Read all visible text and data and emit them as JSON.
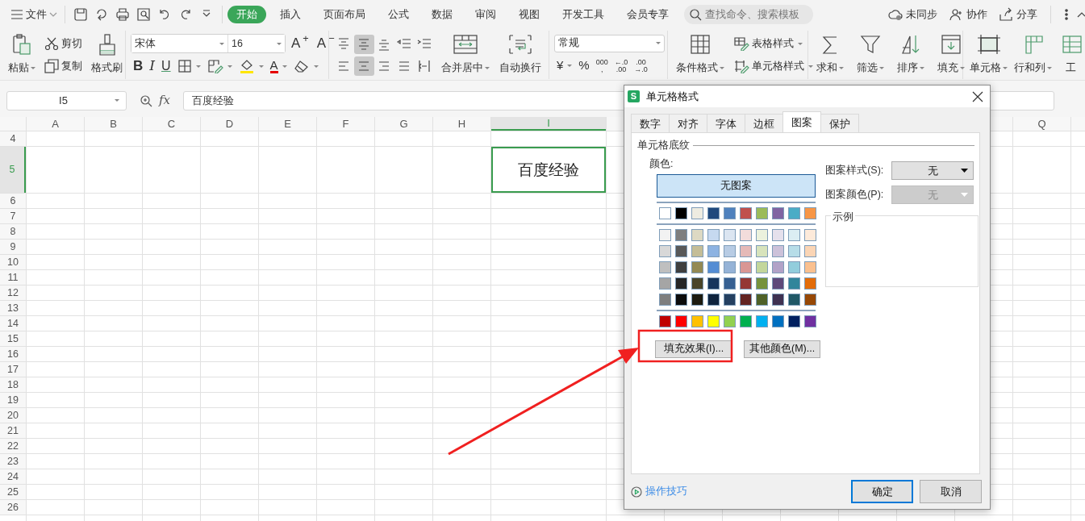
{
  "topbar": {
    "menu": "文件",
    "tabs": [
      {
        "label": "开始",
        "selected": true
      },
      {
        "label": "插入",
        "selected": false
      },
      {
        "label": "页面布局",
        "selected": false
      },
      {
        "label": "公式",
        "selected": false
      },
      {
        "label": "数据",
        "selected": false
      },
      {
        "label": "审阅",
        "selected": false
      },
      {
        "label": "视图",
        "selected": false
      },
      {
        "label": "开发工具",
        "selected": false
      },
      {
        "label": "会员专享",
        "selected": false
      }
    ],
    "search": {
      "placeholder": "查找命令、搜索模板"
    },
    "actions": [
      "未同步",
      "协作",
      "分享"
    ]
  },
  "ribbon": {
    "clipboard": {
      "paste": "粘贴",
      "cut": "剪切",
      "copy": "复制",
      "format_painter": "格式刷"
    },
    "font": {
      "name": "宋体",
      "size": "16",
      "grow": "A$^{+}$",
      "shrink": "A$^{−}$",
      "bold": "B",
      "italic": "I",
      "underline": "U",
      "font_color": "A"
    },
    "alignment": {
      "buttons": [
        {
          "selected": false
        },
        {
          "selected": true
        },
        {
          "selected": false
        },
        {
          "selected": false
        },
        {
          "selected": false
        },
        {
          "selected": false
        },
        {
          "selected": true
        },
        {
          "selected": false
        },
        {
          "selected": false
        },
        {
          "selected": false
        }
      ],
      "merge": "合并居中",
      "wrap": "自动换行"
    },
    "number": {
      "format": "常规",
      "currency": "¥",
      "percent": "%",
      "thousands": [
        "000",
        ","
      ],
      "increase_decimal": [
        "←.0",
        ".00"
      ],
      "decrease_decimal": [
        ".00",
        "→.0"
      ]
    },
    "styles": {
      "conditional": "条件格式",
      "table_style": "表格样式",
      "cell_style": "单元格样式"
    },
    "editing": [
      "求和",
      "筛选",
      "排序",
      "填充"
    ],
    "cells": [
      "单元格",
      "行和列",
      "工"
    ]
  },
  "formula_bar": {
    "name_box": "I5",
    "fx": "fx",
    "value": "百度经验"
  },
  "sheet": {
    "columns_left": [
      {
        "label": "A",
        "selected": false
      },
      {
        "label": "B",
        "selected": false
      },
      {
        "label": "C",
        "selected": false
      },
      {
        "label": "D",
        "selected": false
      },
      {
        "label": "E",
        "selected": false
      },
      {
        "label": "F",
        "selected": false
      },
      {
        "label": "G",
        "selected": false
      },
      {
        "label": "H",
        "selected": false
      },
      {
        "label": "I",
        "selected": true
      }
    ],
    "columns_right": [
      {
        "label": "Q",
        "selected": false
      }
    ],
    "rows": [
      {
        "label": "4",
        "selected": false,
        "tall": false
      },
      {
        "label": "5",
        "selected": true,
        "tall": true
      },
      {
        "label": "6",
        "selected": false,
        "tall": false
      },
      {
        "label": "7",
        "selected": false,
        "tall": false
      },
      {
        "label": "8",
        "selected": false,
        "tall": false
      },
      {
        "label": "9",
        "selected": false,
        "tall": false
      },
      {
        "label": "10",
        "selected": false,
        "tall": false
      },
      {
        "label": "11",
        "selected": false,
        "tall": false
      },
      {
        "label": "12",
        "selected": false,
        "tall": false
      },
      {
        "label": "13",
        "selected": false,
        "tall": false
      },
      {
        "label": "14",
        "selected": false,
        "tall": false
      },
      {
        "label": "15",
        "selected": false,
        "tall": false
      },
      {
        "label": "16",
        "selected": false,
        "tall": false
      },
      {
        "label": "17",
        "selected": false,
        "tall": false
      },
      {
        "label": "18",
        "selected": false,
        "tall": false
      },
      {
        "label": "19",
        "selected": false,
        "tall": false
      },
      {
        "label": "20",
        "selected": false,
        "tall": false
      },
      {
        "label": "21",
        "selected": false,
        "tall": false
      },
      {
        "label": "22",
        "selected": false,
        "tall": false
      },
      {
        "label": "23",
        "selected": false,
        "tall": false
      },
      {
        "label": "24",
        "selected": false,
        "tall": false
      },
      {
        "label": "25",
        "selected": false,
        "tall": false
      },
      {
        "label": "26",
        "selected": false,
        "tall": false
      }
    ],
    "active_cell": {
      "value": "百度经验"
    }
  },
  "dialog": {
    "logo": "S",
    "title": "单元格格式",
    "tabs": [
      {
        "label": "数字",
        "selected": false
      },
      {
        "label": "对齐",
        "selected": false
      },
      {
        "label": "字体",
        "selected": false
      },
      {
        "label": "边框",
        "selected": false
      },
      {
        "label": "图案",
        "selected": true
      },
      {
        "label": "保护",
        "selected": false
      }
    ],
    "section": "单元格底纹",
    "color_label": "颜色:",
    "no_pattern": {
      "label": "无图案",
      "selected": true
    },
    "palette": {
      "theme": [
        {
          "color": "#ffffff"
        },
        {
          "color": "#000000"
        },
        {
          "color": "#eeece1"
        },
        {
          "color": "#1f497d"
        },
        {
          "color": "#4f81bd"
        },
        {
          "color": "#c0504d"
        },
        {
          "color": "#9bbb59"
        },
        {
          "color": "#8064a2"
        },
        {
          "color": "#4bacc6"
        },
        {
          "color": "#f79646"
        }
      ],
      "tints": [
        {
          "swatches": [
            {
              "color": "#f2f2f2"
            },
            {
              "color": "#7f7f7f"
            },
            {
              "color": "#ddd9c3"
            },
            {
              "color": "#c6d9f0"
            },
            {
              "color": "#dbe5f1"
            },
            {
              "color": "#f2dcdb"
            },
            {
              "color": "#ebf1dd"
            },
            {
              "color": "#e5e0ec"
            },
            {
              "color": "#dbeef3"
            },
            {
              "color": "#fdeada"
            }
          ]
        },
        {
          "swatches": [
            {
              "color": "#d8d8d8"
            },
            {
              "color": "#595959"
            },
            {
              "color": "#c4bd97"
            },
            {
              "color": "#8db3e2"
            },
            {
              "color": "#b8cce4"
            },
            {
              "color": "#e5b9b7"
            },
            {
              "color": "#d7e3bc"
            },
            {
              "color": "#ccc1d9"
            },
            {
              "color": "#b7dde8"
            },
            {
              "color": "#fbd5b5"
            }
          ]
        },
        {
          "swatches": [
            {
              "color": "#bfbfbf"
            },
            {
              "color": "#3f3f3f"
            },
            {
              "color": "#938953"
            },
            {
              "color": "#548dd4"
            },
            {
              "color": "#95b3d7"
            },
            {
              "color": "#d99694"
            },
            {
              "color": "#c3d69b"
            },
            {
              "color": "#b2a2c7"
            },
            {
              "color": "#92cddc"
            },
            {
              "color": "#fac08f"
            }
          ]
        },
        {
          "swatches": [
            {
              "color": "#a5a5a5"
            },
            {
              "color": "#262626"
            },
            {
              "color": "#494429"
            },
            {
              "color": "#17365d"
            },
            {
              "color": "#366092"
            },
            {
              "color": "#953734"
            },
            {
              "color": "#76923c"
            },
            {
              "color": "#5f497a"
            },
            {
              "color": "#31859b"
            },
            {
              "color": "#e36c09"
            }
          ]
        },
        {
          "swatches": [
            {
              "color": "#7f7f7f"
            },
            {
              "color": "#0c0c0c"
            },
            {
              "color": "#1d1b10"
            },
            {
              "color": "#0f243e"
            },
            {
              "color": "#244061"
            },
            {
              "color": "#632423"
            },
            {
              "color": "#4f6128"
            },
            {
              "color": "#3f3151"
            },
            {
              "color": "#205867"
            },
            {
              "color": "#974806"
            }
          ]
        }
      ],
      "standard": [
        {
          "color": "#c00000"
        },
        {
          "color": "#ff0000"
        },
        {
          "color": "#ffc000"
        },
        {
          "color": "#ffff00"
        },
        {
          "color": "#92d050"
        },
        {
          "color": "#00b050"
        },
        {
          "color": "#00b0f0"
        },
        {
          "color": "#0070c0"
        },
        {
          "color": "#002060"
        },
        {
          "color": "#7030a0"
        }
      ]
    },
    "fill_effects": "填充效果(I)...",
    "more_colors": "其他颜色(M)...",
    "pattern_style": {
      "label": "图案样式(S):",
      "value": "无",
      "disabled": false
    },
    "pattern_color": {
      "label": "图案颜色(P):",
      "value": "无",
      "disabled": true
    },
    "sample": "示例",
    "tips": "操作技巧",
    "buttons": [
      {
        "label": "确定",
        "default": true
      },
      {
        "label": "取消",
        "default": false
      }
    ]
  }
}
